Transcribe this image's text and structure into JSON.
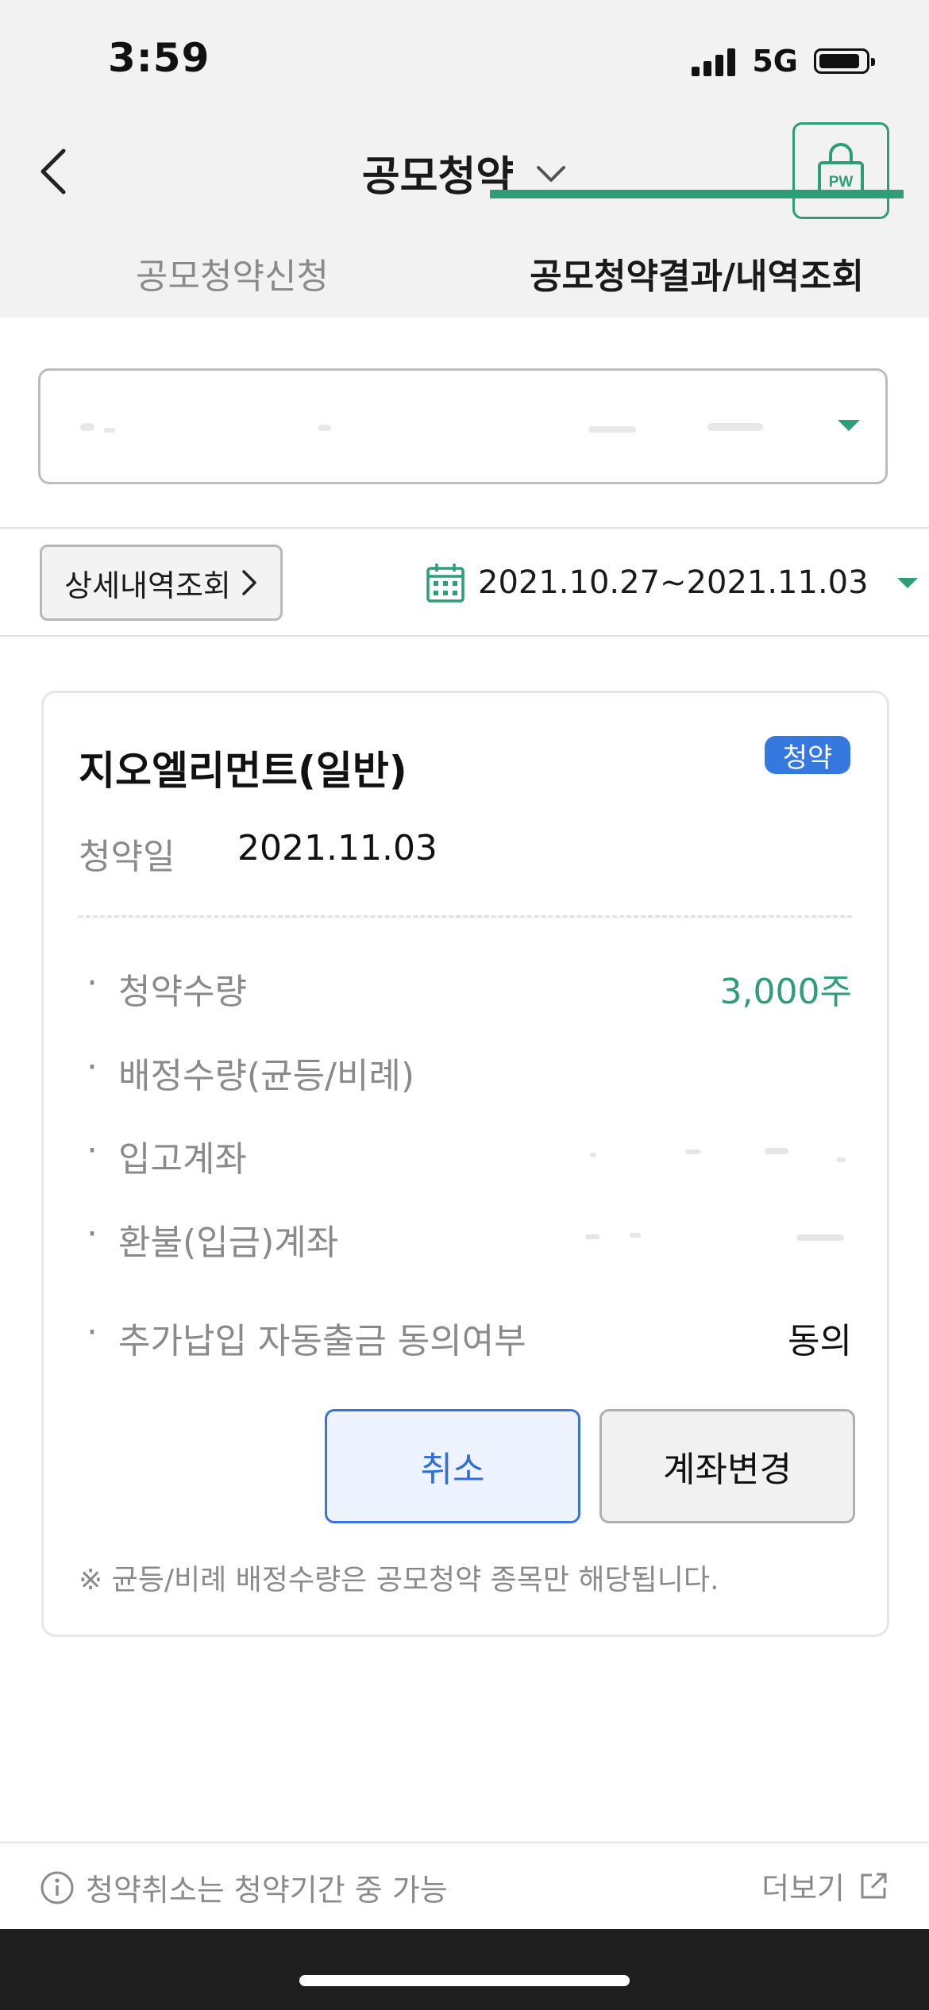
{
  "status_bar": {
    "time": "3:59",
    "network": "5G"
  },
  "header": {
    "title": "공모청약",
    "pw_label": "PW"
  },
  "tabs": [
    {
      "label": "공모청약신청",
      "active": false
    },
    {
      "label": "공모청약결과/내역조회",
      "active": true
    }
  ],
  "filter": {
    "detail_button": "상세내역조회",
    "date_range": "2021.10.27~2021.11.03"
  },
  "card": {
    "stock_name": "지오엘리먼트(일반)",
    "badge": "청약",
    "date_label": "청약일",
    "date_value": "2021.11.03",
    "rows": [
      {
        "label": "청약수량",
        "value": "3,000주"
      },
      {
        "label": "배정수량(균등/비례)",
        "value": ""
      },
      {
        "label": "입고계좌",
        "value": ""
      },
      {
        "label": "환불(입금)계좌",
        "value": ""
      },
      {
        "label": "추가납입 자동출금 동의여부",
        "value": "동의"
      }
    ],
    "cancel_button": "취소",
    "change_account_button": "계좌변경",
    "footnote": "※ 균등/비례 배정수량은 공모청약 종목만 해당됩니다."
  },
  "bottom": {
    "note": "청약취소는 청약기간 중 가능",
    "more_link": "더보기"
  },
  "colors": {
    "accent": "#2d9e78",
    "badge": "#3478e0",
    "cancel": "#2f6fd6"
  },
  "icons": {
    "back": "chevron-left-icon",
    "title_dropdown": "chevron-down-icon",
    "pw": "lock-icon",
    "calendar": "calendar-icon",
    "info": "info-icon",
    "external": "external-link-icon"
  }
}
